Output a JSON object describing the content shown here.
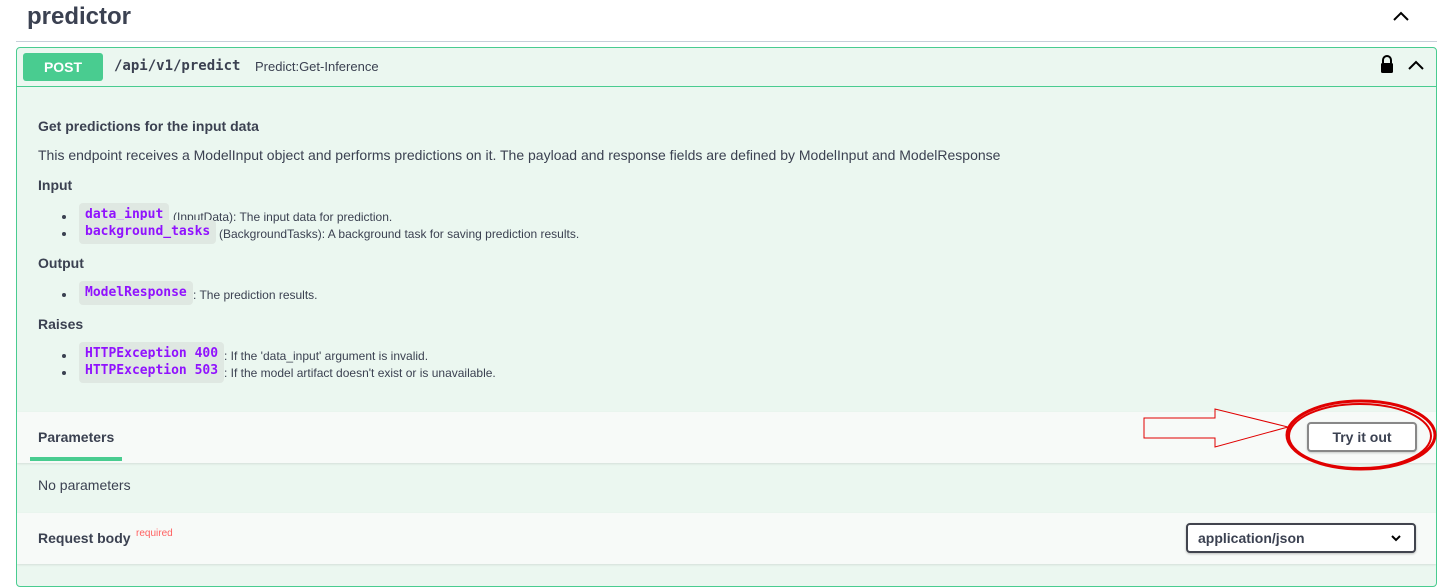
{
  "tag": {
    "title": "predictor"
  },
  "operation": {
    "method": "POST",
    "path": "/api/v1/predict",
    "summary": "Predict:Get-Inference"
  },
  "description": {
    "heading": "Get predictions for the input data",
    "intro": "This endpoint receives a ModelInput object and performs predictions on it. The payload and response fields are defined by ModelInput and ModelResponse",
    "input_heading": "Input",
    "input_items": [
      {
        "code": "data_input",
        "text": "(InputData): The input data for prediction."
      },
      {
        "code": "background_tasks",
        "text": "(BackgroundTasks): A background task for saving prediction results."
      }
    ],
    "output_heading": "Output",
    "output_items": [
      {
        "code": "ModelResponse",
        "text": ": The prediction results."
      }
    ],
    "raises_heading": "Raises",
    "raises_items": [
      {
        "code": "HTTPException 400",
        "text": ": If the 'data_input' argument is invalid."
      },
      {
        "code": "HTTPException 503",
        "text": ": If the model artifact doesn't exist or is unavailable."
      }
    ]
  },
  "parameters": {
    "tab_label": "Parameters",
    "try_button": "Try it out",
    "empty_text": "No parameters"
  },
  "request_body": {
    "title": "Request body",
    "required_label": "required",
    "content_type": "application/json"
  },
  "colors": {
    "post_accent": "#49cc90",
    "panel_bg": "#ebf7f0",
    "code_color": "#9012fe",
    "annotation_red": "#e00000"
  }
}
